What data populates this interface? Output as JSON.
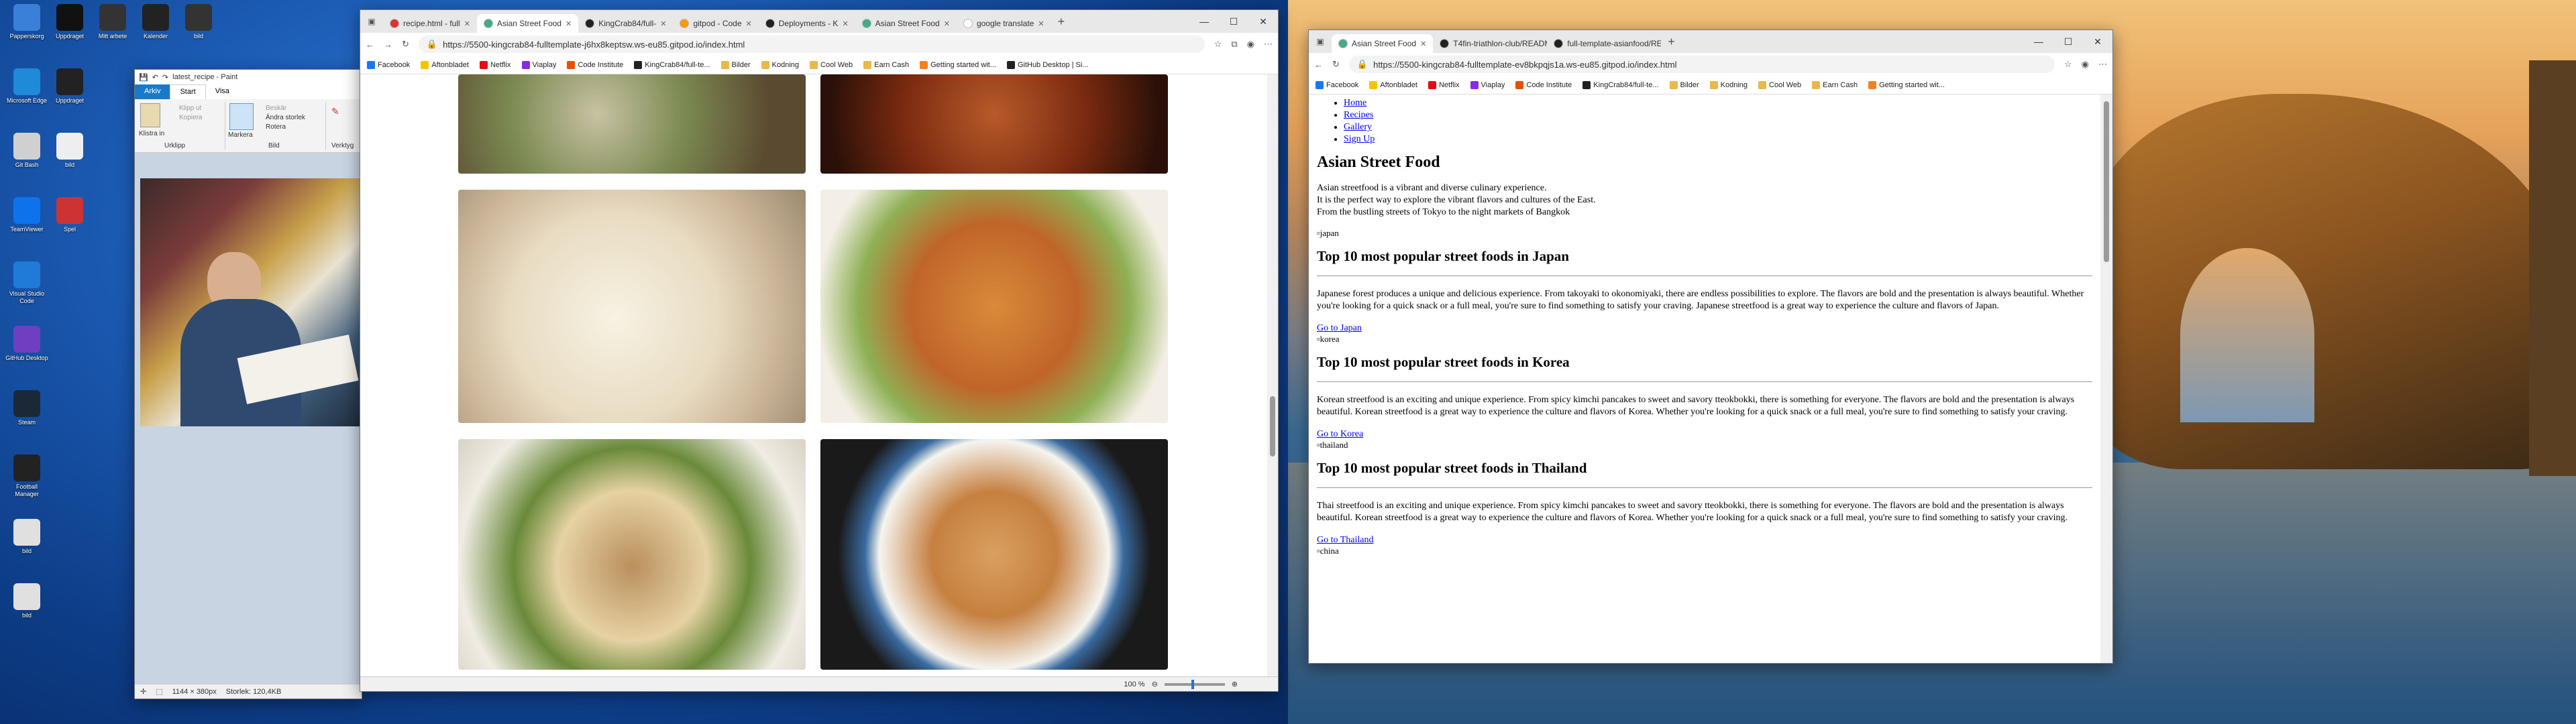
{
  "desktop_left": {
    "icons": [
      {
        "label": "Papperskorg",
        "icon": "recycle-bin-icon",
        "color": "#3a7fd8"
      },
      {
        "label": "Microsoft Edge",
        "icon": "edge-icon",
        "color": "#1f8ad8"
      },
      {
        "label": "Git Bash",
        "icon": "git-bash-icon",
        "color": "#d0d0d0"
      },
      {
        "label": "TeamViewer",
        "icon": "teamviewer-icon",
        "color": "#0e72ed"
      },
      {
        "label": "Visual Studio Code",
        "icon": "vscode-icon",
        "color": "#1f7ad8"
      },
      {
        "label": "GitHub Desktop",
        "icon": "github-desktop-icon",
        "color": "#6e3fc0"
      },
      {
        "label": "Steam",
        "icon": "steam-icon",
        "color": "#1b2838"
      },
      {
        "label": "Football Manager",
        "icon": "football-manager-icon",
        "color": "#222"
      },
      {
        "label": "bild",
        "icon": "file-icon",
        "color": "#e0e0e0"
      },
      {
        "label": "bild",
        "icon": "file-icon",
        "color": "#e0e0e0"
      },
      {
        "label": "Uppdraget",
        "icon": "file-icon",
        "color": "#111"
      },
      {
        "label": "Uppdraget",
        "icon": "file-icon",
        "color": "#222"
      },
      {
        "label": "Mitt arbete",
        "icon": "file-icon",
        "color": "#333"
      },
      {
        "label": "Kalender",
        "icon": "file-icon",
        "color": "#222"
      },
      {
        "label": "bild",
        "icon": "file-icon",
        "color": "#333"
      },
      {
        "label": "bild",
        "icon": "file-icon",
        "color": "#eee"
      },
      {
        "label": "Spel",
        "icon": "file-icon",
        "color": "#c33"
      }
    ]
  },
  "paint": {
    "title": "latest_recipe - Paint",
    "menu": [
      "Arkiv",
      "Start",
      "Visa"
    ],
    "groups": {
      "clipboard": "Urklipp",
      "image": "Bild",
      "tools": "Verktyg"
    },
    "buttons": {
      "paste": "Klistra in",
      "cut": "Klipp ut",
      "copy": "Kopiera",
      "select": "Markera",
      "crop": "Beskär",
      "resize": "Ändra storlek",
      "rotate": "Rotera"
    },
    "status": {
      "dims": "1144 × 380px",
      "size": "Storlek: 120,4KB"
    }
  },
  "browser_left": {
    "tabs": [
      {
        "label": "recipe.html - full",
        "color": "#d33"
      },
      {
        "label": "Asian Street Food",
        "color": "#4a8",
        "active": true
      },
      {
        "label": "KingCrab84/full-",
        "color": "#222"
      },
      {
        "label": "gitpod - Code",
        "color": "#f90"
      },
      {
        "label": "Deployments - K",
        "color": "#222"
      },
      {
        "label": "Asian Street Food",
        "color": "#4a8"
      },
      {
        "label": "google translate",
        "color": "#fff"
      }
    ],
    "url": "https://5500-kingcrab84-fulltemplate-j6hx8keptsw.ws-eu85.gitpod.io/index.html",
    "status": {
      "zoom": "100 %"
    }
  },
  "bookmarks": [
    {
      "label": "Facebook",
      "color": "#1877f2"
    },
    {
      "label": "Aftonbladet",
      "color": "#f4c400"
    },
    {
      "label": "Netflix",
      "color": "#e50914"
    },
    {
      "label": "Viaplay",
      "color": "#8a2be2"
    },
    {
      "label": "Code Institute",
      "color": "#e65100"
    },
    {
      "label": "KingCrab84/full-te...",
      "color": "#222"
    },
    {
      "label": "Bilder",
      "color": "#e8b84a"
    },
    {
      "label": "Kodning",
      "color": "#e8b84a"
    },
    {
      "label": "Cool Web",
      "color": "#e8b84a"
    },
    {
      "label": "Earn Cash",
      "color": "#e8b84a"
    },
    {
      "label": "Getting started wit...",
      "color": "#f48024"
    },
    {
      "label": "GitHub Desktop | Si...",
      "color": "#222"
    }
  ],
  "browser_right": {
    "tabs": [
      {
        "label": "Asian Street Food",
        "color": "#4a8",
        "active": true
      },
      {
        "label": "T4fin-triathlon-club/README.m",
        "color": "#222"
      },
      {
        "label": "full-template-asianfood/README",
        "color": "#222"
      }
    ],
    "url": "https://5500-kingcrab84-fulltemplate-ev8bkpqjs1a.ws-eu85.gitpod.io/index.html",
    "bookmarks_short": [
      "Facebook",
      "Aftonbladet",
      "Netflix",
      "Viaplay",
      "Code Institute",
      "KingCrab84/full-te...",
      "Bilder",
      "Kodning",
      "Cool Web",
      "Earn Cash",
      "Getting started wit..."
    ]
  },
  "site": {
    "nav": [
      "Home",
      "Recipes",
      "Gallery",
      "Sign Up"
    ],
    "title": "Asian Street Food",
    "intro": [
      "Asian streetfood is a vibrant and diverse culinary experience.",
      "It is the perfect way to explore the vibrant flavors and cultures of the East.",
      "From the bustling streets of Tokyo to the night markets of Bangkok"
    ],
    "hero_alt": "japan",
    "sections": [
      {
        "heading": "Top 10 most popular street foods in Japan",
        "text": "Japanese forest produces a unique and delicious experience. From takoyaki to okonomiyaki, there are endless possibilities to explore. The flavors are bold and the presentation is always beautiful. Whether you're looking for a quick snack or a full meal, you're sure to find something to satisfy your craving. Japanese streetfood is a great way to experience the culture and flavors of Japan.",
        "link": "Go to Japan",
        "img_alt": "korea"
      },
      {
        "heading": "Top 10 most popular street foods in Korea",
        "text": "Korean streetfood is an exciting and unique experience. From spicy kimchi pancakes to sweet and savory tteokbokki, there is something for everyone. The flavors are bold and the presentation is always beautiful. Korean streetfood is a great way to experience the culture and flavors of Korea. Whether you're looking for a quick snack or a full meal, you're sure to find something to satisfy your craving.",
        "link": "Go to Korea",
        "img_alt": "thailand"
      },
      {
        "heading": "Top 10 most popular street foods in Thailand",
        "text": "Thai streetfood is an exciting and unique experience. From spicy kimchi pancakes to sweet and savory tteokbokki, there is something for everyone. The flavors are bold and the presentation is always beautiful. Korean streetfood is a great way to experience the culture and flavors of Korea. Whether you're looking for a quick snack or a full meal, you're sure to find something to satisfy your craving.",
        "link": "Go to Thailand",
        "img_alt": "china"
      }
    ]
  }
}
